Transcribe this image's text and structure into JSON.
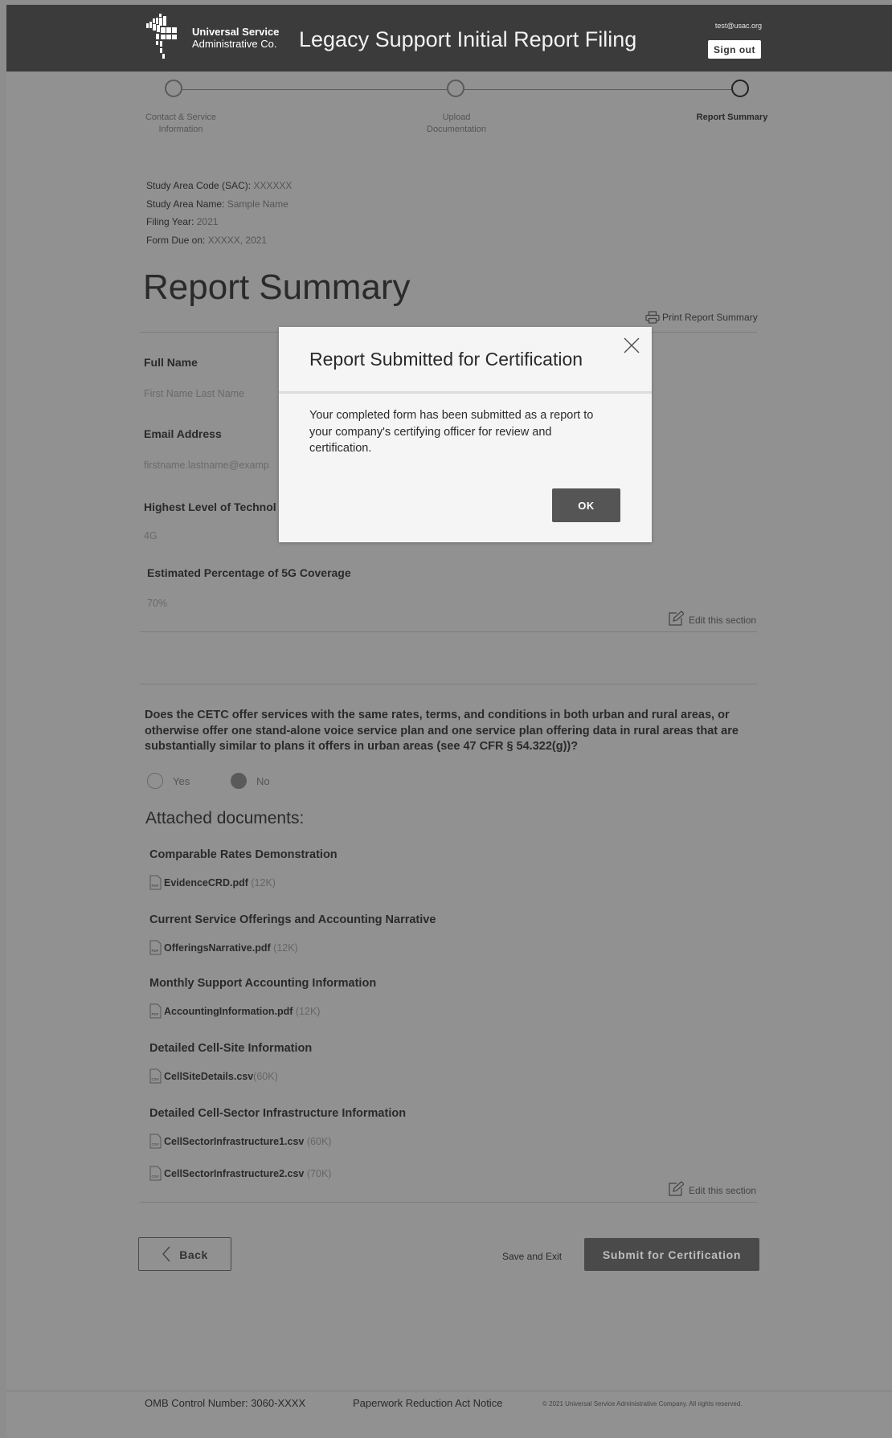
{
  "header": {
    "org_line1": "Universal Service",
    "org_line2": "Administrative Co.",
    "title": "Legacy Support Initial Report Filing",
    "user_email": "test@usac.org",
    "sign_out_label": "Sign out"
  },
  "stepper": {
    "steps": [
      {
        "label_line1": "Contact & Service",
        "label_line2": "Information",
        "state": "complete"
      },
      {
        "label_line1": "Upload",
        "label_line2": "Documentation",
        "state": "complete"
      },
      {
        "label_line1": "Report Summary",
        "label_line2": "",
        "state": "active"
      }
    ]
  },
  "meta": {
    "sac_label": "Study Area Code (SAC):",
    "sac_value": "XXXXXX",
    "name_label": "Study Area Name:",
    "name_value": "Sample Name",
    "year_label": "Filing Year:",
    "year_value": "2021",
    "due_label": "Form Due on:",
    "due_value": "XXXXX, 2021"
  },
  "page_title": "Report Summary",
  "print_label": "Print Report Summary",
  "contact_section": {
    "full_name_label": "Full Name",
    "full_name_value": "First Name Last Name",
    "email_label": "Email Address",
    "email_value": "firstname.lastname@examp",
    "tech_label": "Highest Level of Technol",
    "tech_value": "4G",
    "coverage_label": "Estimated Percentage of 5G Coverage",
    "coverage_value": "70%",
    "edit_label": "Edit this section"
  },
  "question": {
    "text": "Does the CETC offer services with the same rates, terms, and conditions in both urban and rural areas, or otherwise offer one stand-alone voice service plan and one service plan offering data in rural areas that are substantially similar to plans it offers in urban areas (see 47 CFR § 54.322(g))?",
    "yes_label": "Yes",
    "no_label": "No",
    "selected": "No"
  },
  "attachments": {
    "title": "Attached documents:",
    "groups": [
      {
        "heading": "Comparable Rates Demonstration",
        "files": [
          {
            "name": "EvidenceCRD.pdf",
            "size": "(12K)",
            "type": "PDF"
          }
        ]
      },
      {
        "heading": "Current Service Offerings and Accounting Narrative",
        "files": [
          {
            "name": "OfferingsNarrative.pdf",
            "size": "(12K)",
            "type": "PDF"
          }
        ]
      },
      {
        "heading": "Monthly Support Accounting Information",
        "files": [
          {
            "name": "AccountingInformation.pdf",
            "size": "(12K)",
            "type": "PDF"
          }
        ]
      },
      {
        "heading": "Detailed Cell-Site Information",
        "files": [
          {
            "name": "CellSiteDetails.csv",
            "size": "(60K)",
            "type": "CSV"
          }
        ]
      },
      {
        "heading": "Detailed Cell-Sector Infrastructure Information",
        "files": [
          {
            "name": "CellSectorInfrastructure1.csv",
            "size": "(60K)",
            "type": "CSV"
          },
          {
            "name": "CellSectorInfrastructure2.csv",
            "size": "(70K)",
            "type": "CSV"
          }
        ]
      }
    ],
    "edit_label": "Edit this section"
  },
  "actions": {
    "back_label": "Back",
    "save_exit_label": "Save and Exit",
    "submit_label": "Submit for Certification"
  },
  "footer": {
    "omb": "OMB Control Number: 3060-XXXX",
    "pra": "Paperwork Reduction Act Notice",
    "copyright": "© 2021 Universal Service Administrative Company. All rights reserved."
  },
  "modal": {
    "title": "Report Submitted for Certification",
    "body": "Your completed form has been submitted as a report to your company's certifying officer for review and certification.",
    "ok_label": "OK"
  },
  "colors": {
    "page_overlay": "#919191",
    "header_bg": "#3b3b3b",
    "modal_bg": "#f5f5f5",
    "primary_button": "#555555"
  }
}
